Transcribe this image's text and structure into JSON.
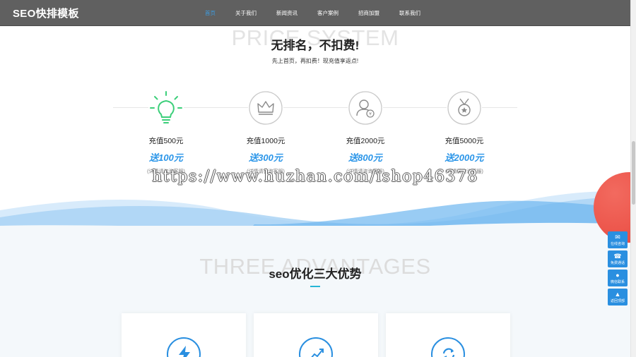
{
  "header": {
    "brand": "SEO快排模板",
    "menu": [
      {
        "label": "首页",
        "active": true
      },
      {
        "label": "关于我们",
        "active": false
      },
      {
        "label": "新闻资讯",
        "active": false
      },
      {
        "label": "客户案例",
        "active": false
      },
      {
        "label": "招商加盟",
        "active": false
      },
      {
        "label": "联系我们",
        "active": false
      }
    ]
  },
  "pricing": {
    "ghost_title": "PRICE SYSTEM",
    "title": "无排名，不扣费!",
    "subtitle": "先上首页，再扣费！现充值享返点!",
    "plans": [
      {
        "icon": "lightbulb-icon",
        "title": "充值500元",
        "gift": "送100元",
        "note": "(详情请咨询客服)"
      },
      {
        "icon": "crown-icon",
        "title": "充值1000元",
        "gift": "送300元",
        "note": "(详情请咨询客服)"
      },
      {
        "icon": "user-badge-icon",
        "title": "充值2000元",
        "gift": "送800元",
        "note": "(详情请咨询客服)"
      },
      {
        "icon": "medal-icon",
        "title": "充值5000元",
        "gift": "送2000元",
        "note": "(详情请咨询客服)"
      }
    ],
    "accent_color": "#2a95e8",
    "highlight_color": "#3ccf7a"
  },
  "watermark": "https://www.huzhan.com/ishop46378",
  "advantages": {
    "ghost_title": "THREE ADVANTAGES",
    "title": "seo优化三大优势",
    "cards": [
      {
        "icon": "lightning-icon"
      },
      {
        "icon": "growth-chart-icon"
      },
      {
        "icon": "refresh-icon"
      }
    ]
  },
  "float_bar": [
    {
      "icon": "chat-icon",
      "label": "在线咨询"
    },
    {
      "icon": "phone-icon",
      "label": "免费通话"
    },
    {
      "icon": "wechat-icon",
      "label": "微信联系"
    },
    {
      "icon": "arrow-up-icon",
      "label": "返回顶部"
    }
  ]
}
